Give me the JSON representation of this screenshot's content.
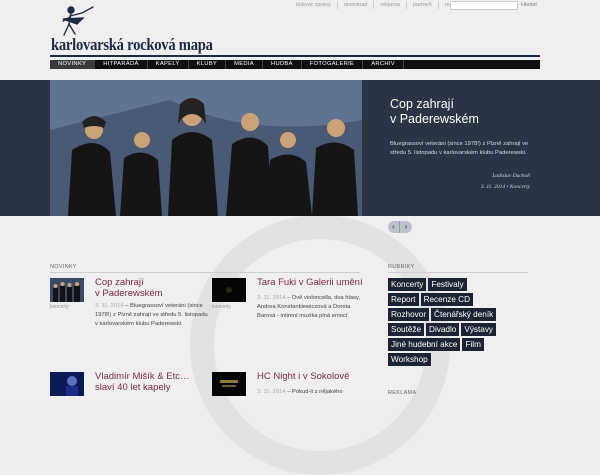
{
  "toplinks": [
    "tiskové zprávy",
    "download",
    "reklama",
    "partneři",
    "redakce"
  ],
  "search": {
    "placeholder": "",
    "button": "Hledat"
  },
  "logo": {
    "title": "karlovarská rocková mapa"
  },
  "nav": [
    "NOVINKY",
    "HITPARÁDA",
    "KAPELY",
    "KLUBY",
    "MEDIA",
    "HUDBA",
    "FOTOGALERIE",
    "ARCHIV"
  ],
  "hero": {
    "title_line1": "Cop zahrají",
    "title_line2": "v Paderewském",
    "desc": "Bluegrassoví veteráni (since 1978!) z Plzně zahrají ve středu 5. listopadu v karlovarském klubu Paderewski.",
    "author": "Ladislav Duchoň",
    "date": "3. 11. 2014 • Koncerty"
  },
  "sections": {
    "news": "NOVINKY",
    "categories": "RUBRIKY",
    "ads": "REKLAMA"
  },
  "articles": [
    {
      "category": "koncerty",
      "title_line1": "Cop zahrají",
      "title_line2": "v Paderewském",
      "date": "3. 11. 2014",
      "text_first": " – Bluegrassoví veteráni",
      "text_rest": "(since 1978!) z Plzně zahrají ve středu 5. listopadu v karlovarském klubu Paderewski."
    },
    {
      "category": "koncerty",
      "title_line1": "Tara Fuki v Galerii umění",
      "title_line2": "",
      "date": "3. 11. 2014",
      "text_first": " – Dvě violoncella, dva",
      "text_rest": "hlasy, Andrea Konstankiewiczová a Dorota Barová - intimní muzika plná emocí"
    },
    {
      "category": "",
      "title_line1": "Vladimír Mišík & Etc…",
      "title_line2": "slaví 40 let kapely",
      "date": "",
      "text_first": "",
      "text_rest": ""
    },
    {
      "category": "",
      "title_line1": "HC Night i v Sokolově",
      "title_line2": "",
      "date": "3. 11. 2014",
      "text_first": " – Pokud-li z nějakého",
      "text_rest": ""
    }
  ],
  "tags": [
    "Koncerty",
    "Festivaly",
    "Report",
    "Recenze CD",
    "Rozhovor",
    "Čtenářský deník",
    "Soutěže",
    "Divadlo",
    "Výstavy",
    "Jiné hudební akce",
    "Film",
    "Workshop"
  ],
  "colors": {
    "navy": "#1d2a44",
    "hero_bg": "#2a3444",
    "title_accent": "#7a2a44"
  }
}
